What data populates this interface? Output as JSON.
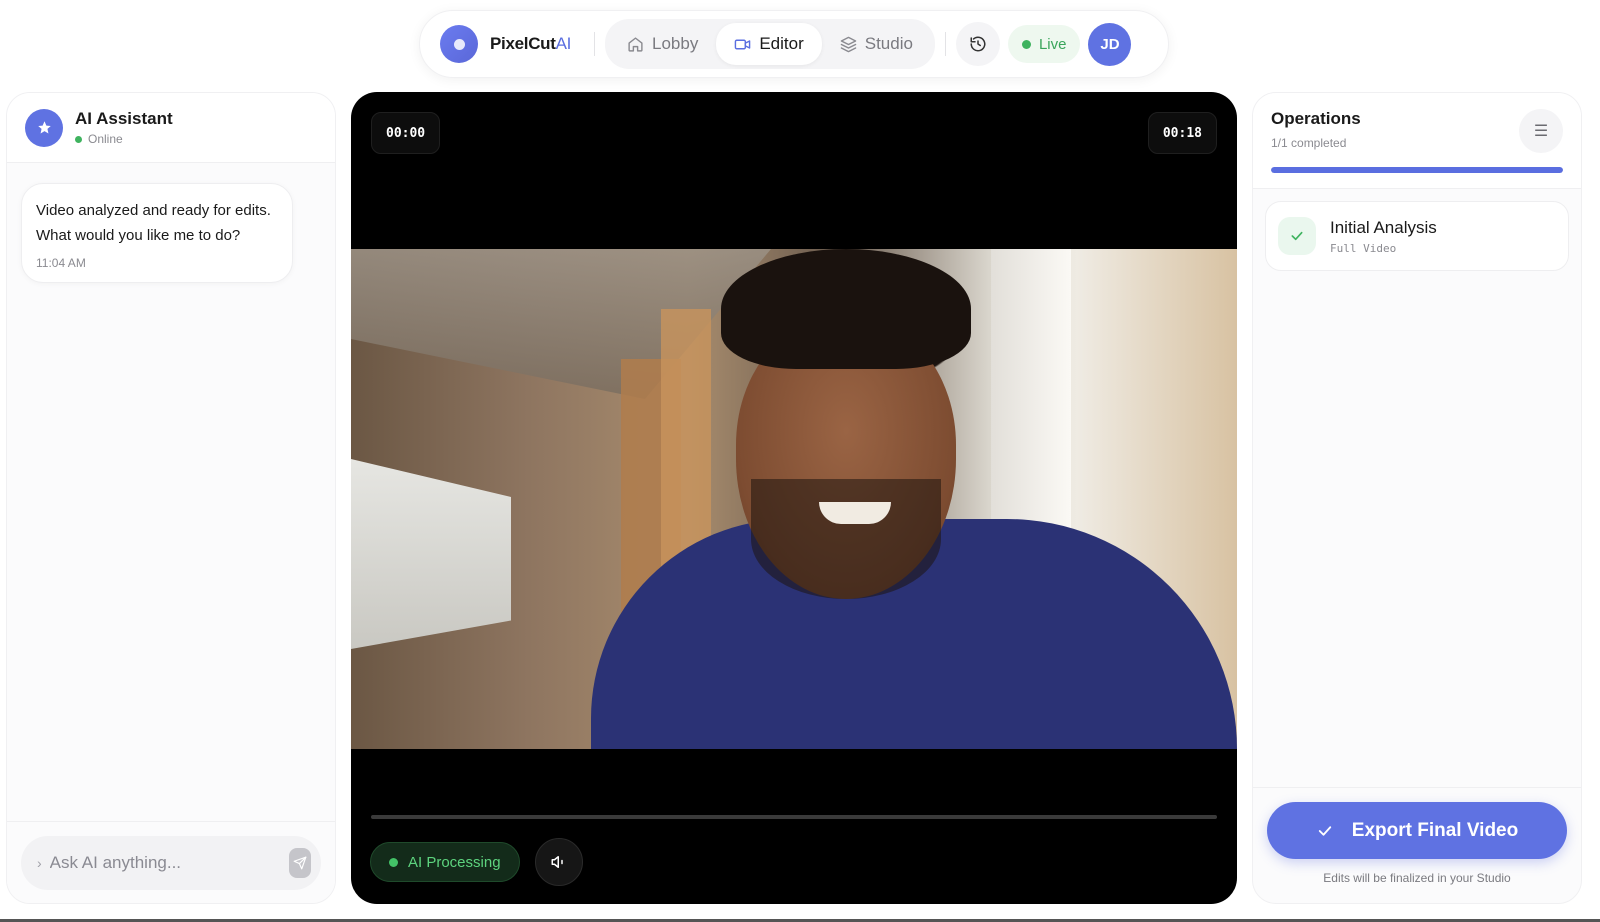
{
  "nav": {
    "brand_name": "PixelCut",
    "brand_suffix": "AI",
    "tabs": [
      {
        "label": "Lobby",
        "icon": "home-icon"
      },
      {
        "label": "Editor",
        "icon": "video-camera-icon",
        "active": true
      },
      {
        "label": "Studio",
        "icon": "layers-icon"
      }
    ],
    "history_icon": "history-icon",
    "live_label": "Live",
    "avatar_initials": "JD"
  },
  "assistant": {
    "title": "AI Assistant",
    "status": "Online",
    "messages": [
      {
        "text": "Video analyzed and ready for edits. What would you like me to do?",
        "time": "11:04 AM"
      }
    ],
    "input_placeholder": "Ask AI anything...",
    "input_value": "",
    "send_icon": "send-icon"
  },
  "player": {
    "current_time": "00:00",
    "duration": "00:18",
    "progress": 0,
    "status_label": "AI Processing",
    "mute_icon": "speaker-muted-icon"
  },
  "operations": {
    "title": "Operations",
    "summary": "1/1 completed",
    "progress": 1.0,
    "items": [
      {
        "title": "Initial Analysis",
        "scope": "Full Video",
        "status": "done"
      }
    ],
    "export_label": "Export Final Video",
    "export_note": "Edits will be finalized in your Studio"
  },
  "colors": {
    "accent": "#5f72e2",
    "live_green": "#3fb35f",
    "processing_green": "#5dd37e"
  }
}
